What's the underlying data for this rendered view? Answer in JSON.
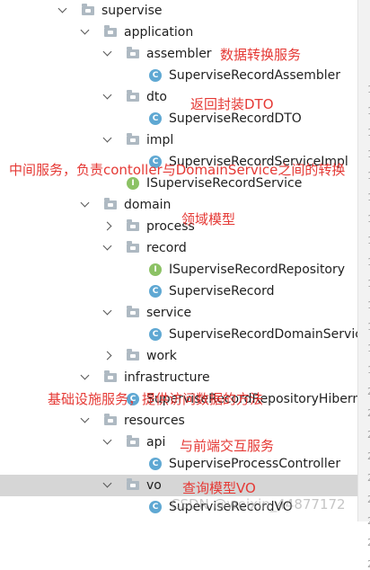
{
  "tree": {
    "nodes": [
      {
        "label": "supervise",
        "kind": "folder",
        "expanded": true
      },
      {
        "label": "application",
        "kind": "folder",
        "expanded": true
      },
      {
        "label": "assembler",
        "kind": "folder",
        "expanded": true
      },
      {
        "label": "SuperviseRecordAssembler",
        "kind": "class"
      },
      {
        "label": "dto",
        "kind": "folder",
        "expanded": true
      },
      {
        "label": "SuperviseRecordDTO",
        "kind": "class"
      },
      {
        "label": "impl",
        "kind": "folder",
        "expanded": true
      },
      {
        "label": "SuperviseRecordServiceImpl",
        "kind": "class"
      },
      {
        "label": "ISuperviseRecordService",
        "kind": "interface"
      },
      {
        "label": "domain",
        "kind": "folder",
        "expanded": true
      },
      {
        "label": "process",
        "kind": "folder",
        "expanded": false
      },
      {
        "label": "record",
        "kind": "folder",
        "expanded": true
      },
      {
        "label": "ISuperviseRecordRepository",
        "kind": "interface"
      },
      {
        "label": "SuperviseRecord",
        "kind": "class"
      },
      {
        "label": "service",
        "kind": "folder",
        "expanded": true
      },
      {
        "label": "SuperviseRecordDomainService",
        "kind": "class"
      },
      {
        "label": "work",
        "kind": "folder",
        "expanded": false
      },
      {
        "label": "infrastructure",
        "kind": "folder",
        "expanded": true
      },
      {
        "label": "SuperviseRecordRepositoryHibernate",
        "kind": "class"
      },
      {
        "label": "resources",
        "kind": "folder",
        "expanded": true
      },
      {
        "label": "api",
        "kind": "folder",
        "expanded": true
      },
      {
        "label": "SuperviseProcessController",
        "kind": "class"
      },
      {
        "label": "vo",
        "kind": "folder",
        "expanded": true,
        "selected": true
      },
      {
        "label": "SuperviseRecordVO",
        "kind": "class"
      }
    ],
    "icon_letters": {
      "class": "C",
      "interface": "I"
    }
  },
  "gutter_numbers": [
    "1",
    "1",
    "1",
    "1",
    "1",
    "1",
    "1",
    "1",
    "1",
    "1",
    "1",
    "1",
    "1",
    "1",
    "2",
    "2",
    "2",
    "2",
    "2",
    "2",
    "2",
    "2",
    "2"
  ],
  "annotations": [
    "数据转换服务",
    "返回封装DTO",
    "中间服务，负责contoller与DomainService之间的转换",
    "领域模型",
    "基础设施服务，提供访问数据的方法",
    "与前端交互服务",
    "查询模型VO"
  ],
  "watermark": "CSDN @weixin_44877172",
  "colors": {
    "annotation": "#e53935",
    "class_icon": "#5fa8d3",
    "interface_icon": "#8cc265",
    "folder_icon": "#aeb9c2",
    "selection": "#d6d6d6"
  }
}
